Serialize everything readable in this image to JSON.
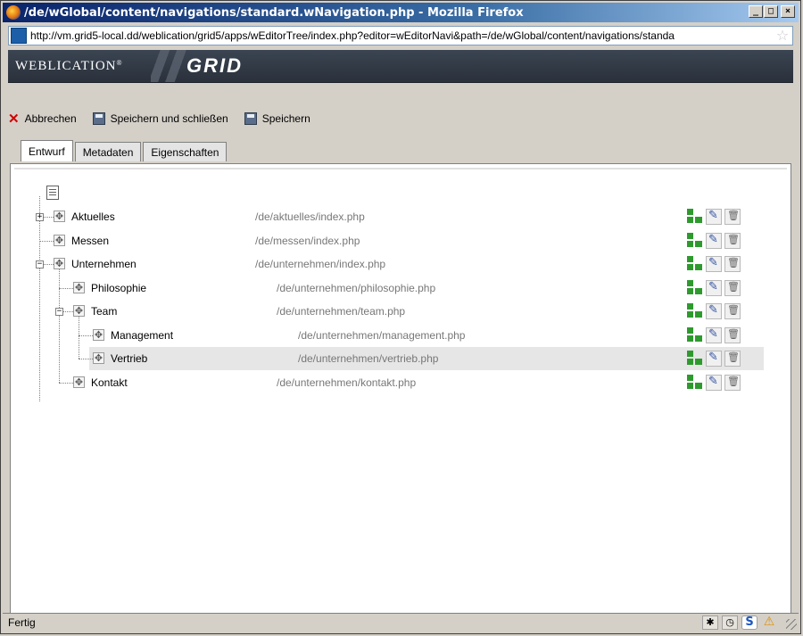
{
  "window": {
    "title": "/de/wGlobal/content/navigations/standard.wNavigation.php - Mozilla Firefox",
    "minimize": "_",
    "maximize": "□",
    "close": "×"
  },
  "urlbar": {
    "url": "http://vm.grid5-local.dd/weblication/grid5/apps/wEditorTree/index.php?editor=wEditorNavi&path=/de/wGlobal/content/navigations/standa"
  },
  "app": {
    "brand": "Weblication",
    "reg": "®",
    "product": "GRID"
  },
  "toolbar": {
    "cancel_label": "Abbrechen",
    "save_close_label": "Speichern und schließen",
    "save_label": "Speichern"
  },
  "tabs": [
    {
      "label": "Entwurf",
      "active": true
    },
    {
      "label": "Metadaten",
      "active": false
    },
    {
      "label": "Eigenschaften",
      "active": false
    }
  ],
  "tree": [
    {
      "label": "Aktuelles",
      "path": "/de/aktuelles/index.php",
      "expander": "+"
    },
    {
      "label": "Messen",
      "path": "/de/messen/index.php",
      "expander": ""
    },
    {
      "label": "Unternehmen",
      "path": "/de/unternehmen/index.php",
      "expander": "−"
    },
    {
      "label": "Philosophie",
      "path": "/de/unternehmen/philosophie.php",
      "expander": ""
    },
    {
      "label": "Team",
      "path": "/de/unternehmen/team.php",
      "expander": "−"
    },
    {
      "label": "Management",
      "path": "/de/unternehmen/management.php",
      "expander": ""
    },
    {
      "label": "Vertrieb",
      "path": "/de/unternehmen/vertrieb.php",
      "expander": "",
      "selected": true
    },
    {
      "label": "Kontakt",
      "path": "/de/unternehmen/kontakt.php",
      "expander": ""
    }
  ],
  "status": {
    "text": "Fertig",
    "icons": [
      "satellite-icon",
      "clock-icon",
      "s-icon",
      "warning-icon"
    ]
  },
  "colors": {
    "header_bg": "#2f3641",
    "accent_green": "#2e9a2e",
    "cancel_red": "#d00000",
    "path_gray": "#777777"
  }
}
